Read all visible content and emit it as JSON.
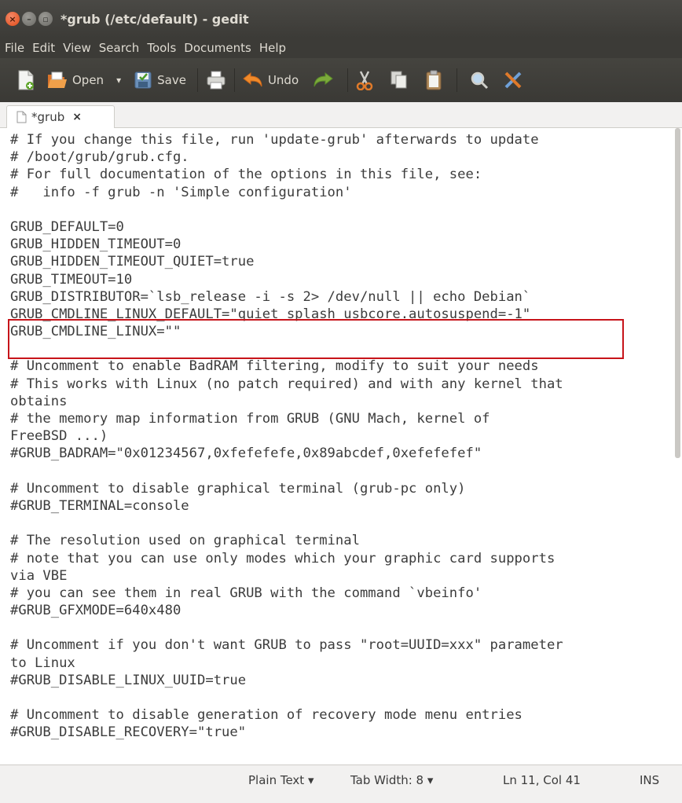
{
  "window": {
    "title": "*grub (/etc/default) - gedit"
  },
  "menubar": [
    "File",
    "Edit",
    "View",
    "Search",
    "Tools",
    "Documents",
    "Help"
  ],
  "toolbar": {
    "open_label": "Open",
    "save_label": "Save",
    "undo_label": "Undo"
  },
  "tab": {
    "label": "*grub",
    "close": "×"
  },
  "editor": {
    "lines": [
      "# If you change this file, run 'update-grub' afterwards to update",
      "# /boot/grub/grub.cfg.",
      "# For full documentation of the options in this file, see:",
      "#   info -f grub -n 'Simple configuration'",
      "",
      "GRUB_DEFAULT=0",
      "GRUB_HIDDEN_TIMEOUT=0",
      "GRUB_HIDDEN_TIMEOUT_QUIET=true",
      "GRUB_TIMEOUT=10",
      "GRUB_DISTRIBUTOR=`lsb_release -i -s 2> /dev/null || echo Debian`",
      "GRUB_CMDLINE_LINUX_DEFAULT=\"quiet splash usbcore.autosuspend=-1\"",
      "GRUB_CMDLINE_LINUX=\"\"",
      "",
      "# Uncomment to enable BadRAM filtering, modify to suit your needs",
      "# This works with Linux (no patch required) and with any kernel that",
      "obtains",
      "# the memory map information from GRUB (GNU Mach, kernel of",
      "FreeBSD ...)",
      "#GRUB_BADRAM=\"0x01234567,0xfefefefe,0x89abcdef,0xefefefef\"",
      "",
      "# Uncomment to disable graphical terminal (grub-pc only)",
      "#GRUB_TERMINAL=console",
      "",
      "# The resolution used on graphical terminal",
      "# note that you can use only modes which your graphic card supports",
      "via VBE",
      "# you can see them in real GRUB with the command `vbeinfo'",
      "#GRUB_GFXMODE=640x480",
      "",
      "# Uncomment if you don't want GRUB to pass \"root=UUID=xxx\" parameter",
      "to Linux",
      "#GRUB_DISABLE_LINUX_UUID=true",
      "",
      "# Uncomment to disable generation of recovery mode menu entries",
      "#GRUB_DISABLE_RECOVERY=\"true\""
    ]
  },
  "statusbar": {
    "syntax": "Plain Text ▾",
    "tab_width": "Tab Width: 8 ▾",
    "position": "Ln 11, Col 41",
    "mode": "INS"
  },
  "colors": {
    "highlight_box": "#c7141a",
    "titlebar": "#3c3b37",
    "close_button": "#df4a16"
  }
}
